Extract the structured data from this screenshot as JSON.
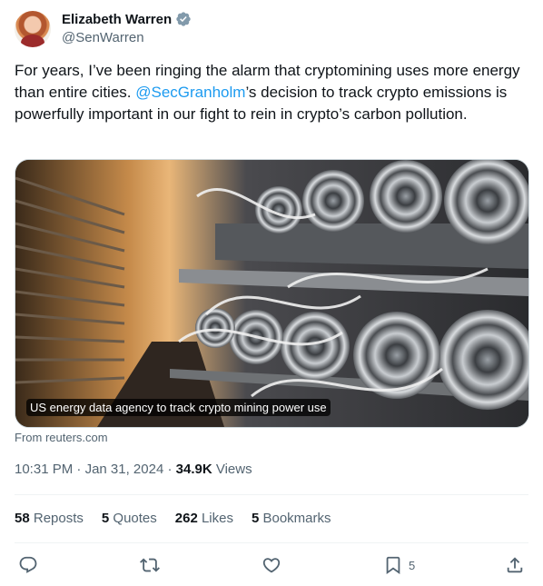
{
  "author": {
    "name": "Elizabeth Warren",
    "handle": "@SenWarren"
  },
  "tweet": {
    "text_before": "For years, I’ve been ringing the alarm that cryptomining uses more energy than entire cities. ",
    "mention": "@SecGranholm",
    "text_after": "’s decision to track crypto emissions is powerfully important in our fight to rein in crypto’s carbon pollution."
  },
  "card": {
    "caption": "US energy data agency to track crypto mining power use",
    "source": "From reuters.com"
  },
  "meta": {
    "time": "10:31 PM",
    "separator1": " · ",
    "date": "Jan 31, 2024",
    "separator2": " · ",
    "views_count": "34.9K",
    "views_label": " Views"
  },
  "stats": {
    "reposts": {
      "count": "58",
      "label": " Reposts"
    },
    "quotes": {
      "count": "5",
      "label": " Quotes"
    },
    "likes": {
      "count": "262",
      "label": " Likes"
    },
    "bookmarks": {
      "count": "5",
      "label": " Bookmarks"
    }
  },
  "actions": {
    "bookmark_count": "5"
  },
  "icons": [
    "verified-icon",
    "reply-icon",
    "repost-icon",
    "like-icon",
    "bookmark-icon",
    "share-icon"
  ],
  "colors": {
    "link": "#1d9bf0",
    "secondary_text": "#536471",
    "verified": "#829aab"
  }
}
